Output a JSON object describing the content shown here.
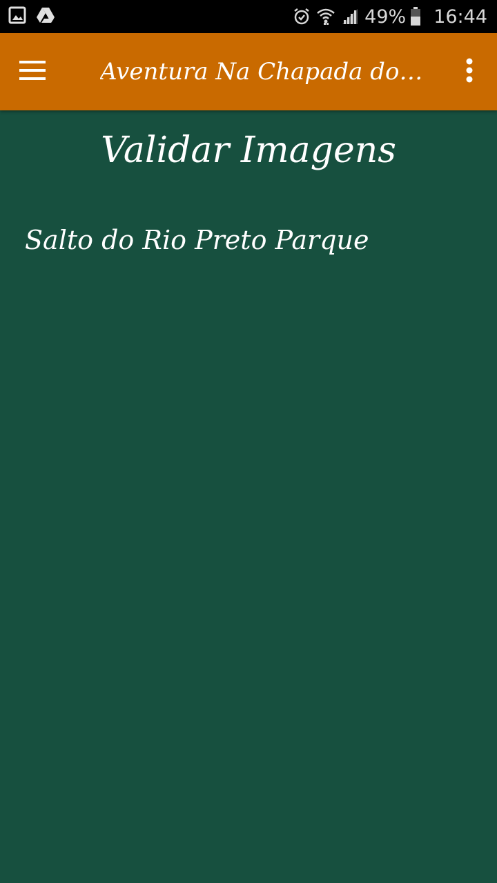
{
  "status_bar": {
    "left_icons": [
      "gallery-icon",
      "drive-icon"
    ],
    "right_icons": [
      "alarm-icon",
      "wifi-icon",
      "signal-icon"
    ],
    "battery_percent": "49%",
    "battery_icon": "battery-icon",
    "time": "16:44"
  },
  "app_bar": {
    "title": "Aventura Na Chapada dos...",
    "menu_icon": "hamburger-menu-icon",
    "overflow_icon": "more-vert-icon",
    "background_color": "#c96a00"
  },
  "content": {
    "page_title": "Validar Imagens",
    "items": [
      {
        "label": "Salto do Rio Preto Parque"
      }
    ],
    "background_color": "#17503f"
  }
}
